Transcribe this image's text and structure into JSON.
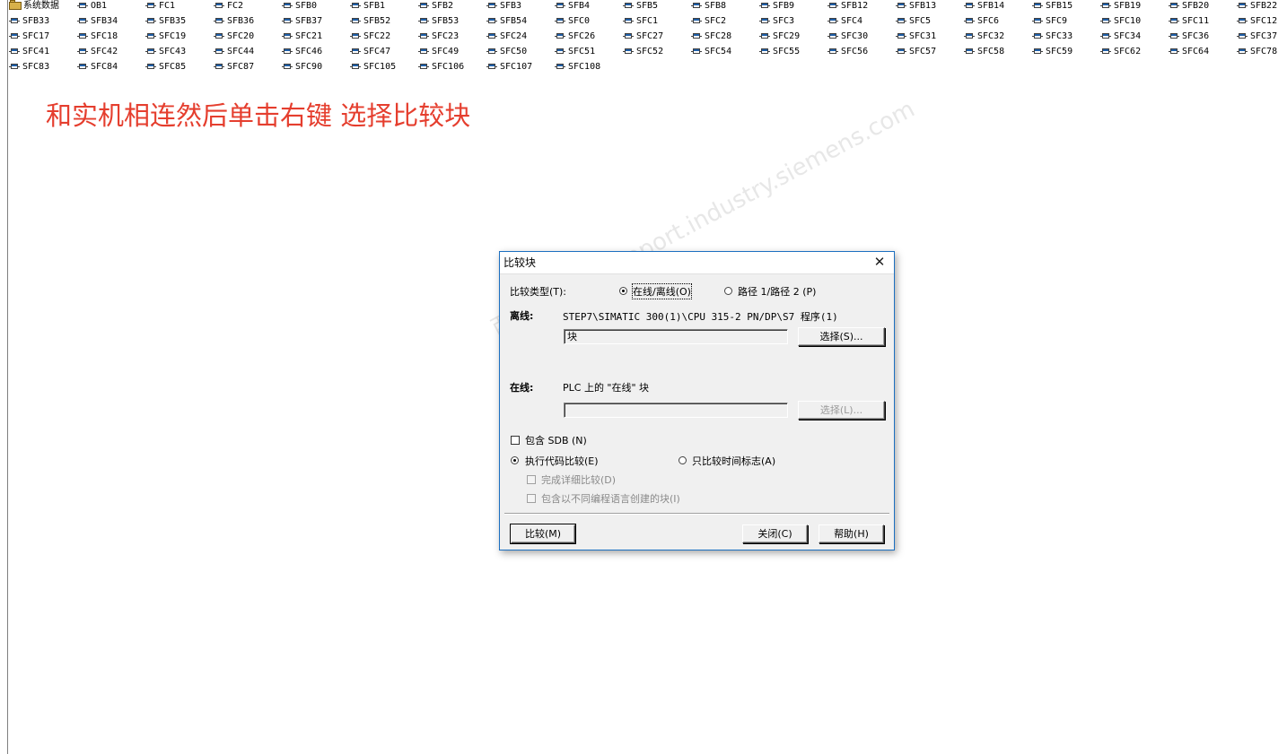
{
  "blocks": [
    [
      "系统数据",
      "OB1",
      "FC1",
      "FC2",
      "SFB0",
      "SFB1",
      "SFB2",
      "SFB3",
      "SFB4",
      "SFB5",
      "SFB8",
      "SFB9",
      "SFB12",
      "SFB13",
      "SFB14",
      "SFB15",
      "SFB19",
      "SFB20",
      "SFB22"
    ],
    [
      "SFB33",
      "SFB34",
      "SFB35",
      "SFB36",
      "SFB37",
      "SFB52",
      "SFB53",
      "SFB54",
      "SFC0",
      "SFC1",
      "SFC2",
      "SFC3",
      "SFC4",
      "SFC5",
      "SFC6",
      "SFC9",
      "SFC10",
      "SFC11",
      "SFC12"
    ],
    [
      "SFC17",
      "SFC18",
      "SFC19",
      "SFC20",
      "SFC21",
      "SFC22",
      "SFC23",
      "SFC24",
      "SFC26",
      "SFC27",
      "SFC28",
      "SFC29",
      "SFC30",
      "SFC31",
      "SFC32",
      "SFC33",
      "SFC34",
      "SFC36",
      "SFC37"
    ],
    [
      "SFC41",
      "SFC42",
      "SFC43",
      "SFC44",
      "SFC46",
      "SFC47",
      "SFC49",
      "SFC50",
      "SFC51",
      "SFC52",
      "SFC54",
      "SFC55",
      "SFC56",
      "SFC57",
      "SFC58",
      "SFC59",
      "SFC62",
      "SFC64",
      "SFC78"
    ],
    [
      "SFC83",
      "SFC84",
      "SFC85",
      "SFC87",
      "SFC90",
      "SFC105",
      "SFC106",
      "SFC107",
      "SFC108"
    ]
  ],
  "annotation": "和实机相连然后单击右键 选择比较块",
  "watermark": "西门子工业 support.industry.siemens.com",
  "dialog": {
    "title": "比较块",
    "compare_type_label": "比较类型(T):",
    "radio_online_offline": "在线/离线(O)",
    "radio_path": "路径 1/路径 2 (P)",
    "offline_label": "离线:",
    "offline_path": "STEP7\\SIMATIC 300(1)\\CPU 315-2 PN/DP\\S7 程序(1)",
    "offline_field_value": "块",
    "select_button_1": "选择(S)...",
    "online_label": "在线:",
    "online_text": "PLC 上的 \"在线\" 块",
    "online_field_value": "",
    "select_button_2": "选择(L)...",
    "include_sdb": "包含 SDB (N)",
    "radio_code_compare": "执行代码比较(E)",
    "radio_timestamp_only": "只比较时间标志(A)",
    "detailed_compare": "完成详细比较(D)",
    "include_other_lang": "包含以不同编程语言创建的块(I)",
    "compare_button": "比较(M)",
    "close_button": "关闭(C)",
    "help_button": "帮助(H)"
  },
  "colors": {
    "annotation": "#e53e2e",
    "dialog_border": "#1c6fc0",
    "block_icon_accent": "#1f5fa8"
  }
}
